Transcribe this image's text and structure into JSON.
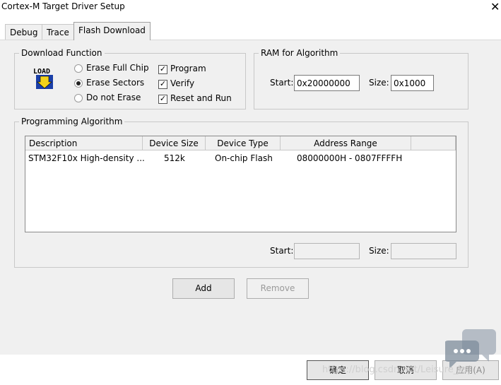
{
  "window": {
    "title": "Cortex-M Target Driver Setup",
    "close_glyph": "✕"
  },
  "tabs": [
    {
      "label": "Debug",
      "active": false
    },
    {
      "label": "Trace",
      "active": false
    },
    {
      "label": "Flash Download",
      "active": true
    }
  ],
  "download_function": {
    "title": "Download Function",
    "icon": "load-icon",
    "icon_text": "LOAD",
    "erase_options": [
      {
        "label": "Erase Full Chip",
        "selected": false
      },
      {
        "label": "Erase Sectors",
        "selected": true
      },
      {
        "label": "Do not Erase",
        "selected": false
      }
    ],
    "checks": [
      {
        "label": "Program",
        "checked": true
      },
      {
        "label": "Verify",
        "checked": true
      },
      {
        "label": "Reset and Run",
        "checked": true
      }
    ]
  },
  "ram": {
    "title": "RAM for Algorithm",
    "start_label": "Start:",
    "start_value": "0x20000000",
    "size_label": "Size:",
    "size_value": "0x1000"
  },
  "programming": {
    "title": "Programming Algorithm",
    "columns": [
      "Description",
      "Device Size",
      "Device Type",
      "Address Range"
    ],
    "rows": [
      {
        "description": "STM32F10x High-density ...",
        "size": "512k",
        "type": "On-chip Flash",
        "range": "08000000H - 0807FFFFH"
      }
    ],
    "start_label": "Start:",
    "start_value": "",
    "size_label": "Size:",
    "size_value": ""
  },
  "buttons": {
    "add": "Add",
    "remove": "Remove",
    "ok": "确定",
    "cancel": "取消",
    "apply": "应用(A)"
  },
  "watermark": {
    "text": "https://blog.csdn.net/Leisure_ksj"
  }
}
